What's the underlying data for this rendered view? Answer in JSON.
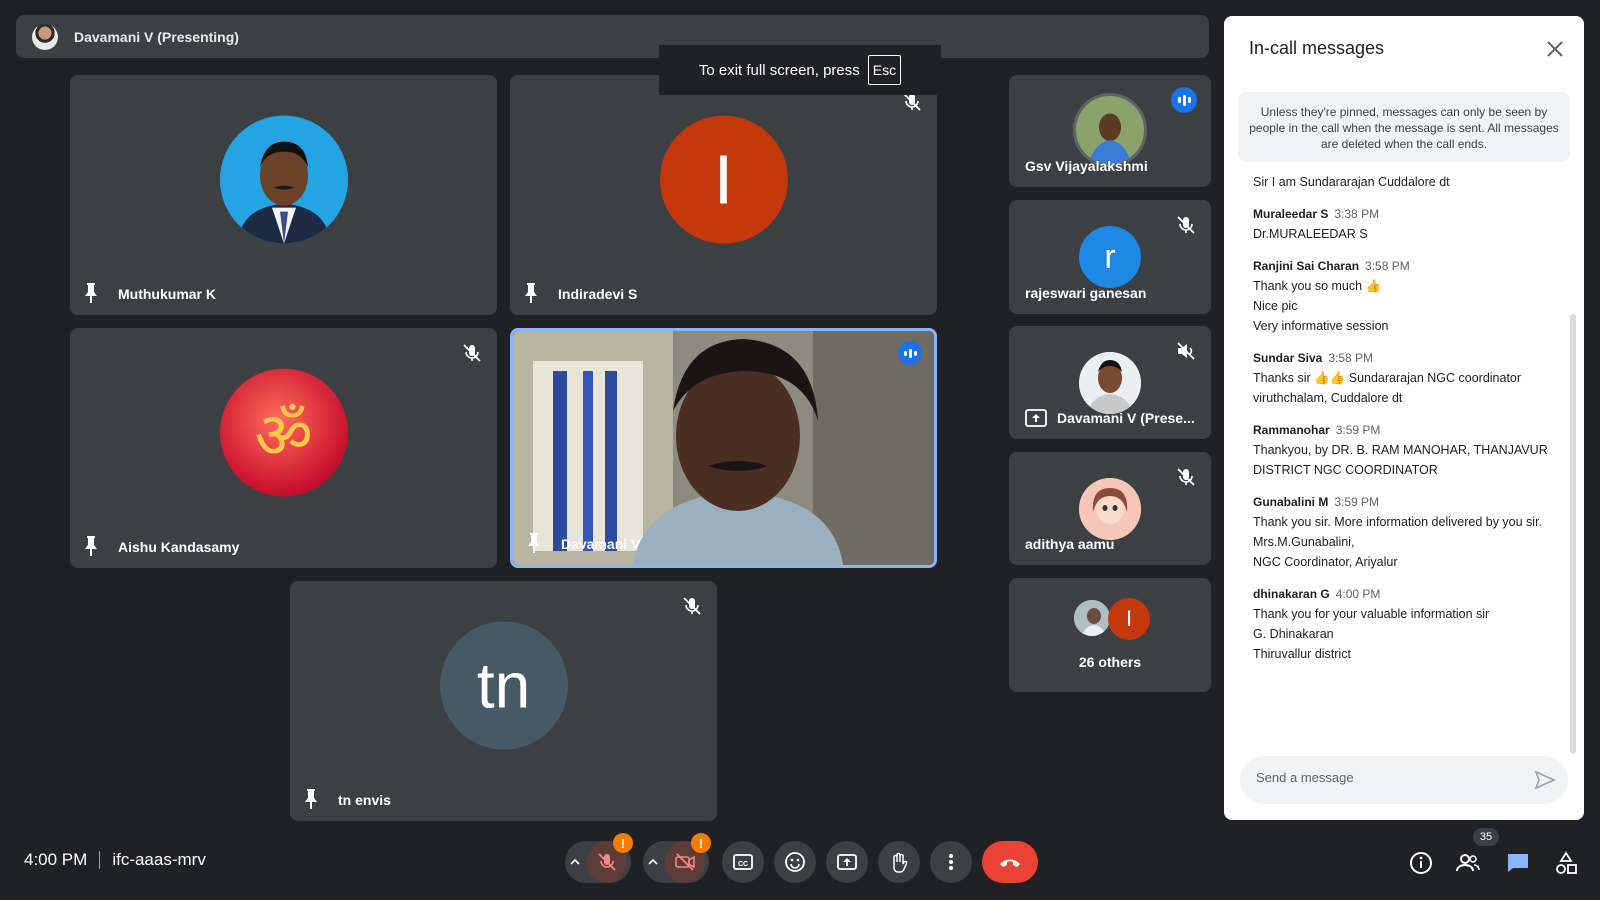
{
  "presenter_bar": {
    "title": "Davamani V (Presenting)"
  },
  "toast": {
    "text": "To exit full screen, press",
    "key": "Esc"
  },
  "tiles": {
    "muthukumar": {
      "name": "Muthukumar K"
    },
    "indiradevi": {
      "name": "Indiradevi S",
      "initial": "I",
      "color": "#c5380c"
    },
    "aishu": {
      "name": "Aishu Kandasamy"
    },
    "davamani_video": {
      "name": "Davamani V"
    },
    "tn_envis": {
      "name": "tn envis",
      "initial": "tn",
      "color": "#455a64"
    }
  },
  "side_tiles": {
    "gsv": {
      "name": "Gsv Vijayalakshmi"
    },
    "rajeswari": {
      "name": "rajeswari ganesan",
      "initial": "r",
      "color": "#1e88e5"
    },
    "davamani_present": {
      "name": "Davamani V (Prese..."
    },
    "adithya": {
      "name": "adithya aamu"
    },
    "others": {
      "label": "26 others",
      "initial": "I",
      "color": "#c5380c"
    }
  },
  "chat": {
    "title": "In-call messages",
    "notice": "Unless they're pinned, messages can only be seen by people in the call when the message is sent. All messages are deleted when the call ends.",
    "cut_line": "Sir I am Sundararajan Cuddalore dt",
    "messages": [
      {
        "sender": "Muraleedar S",
        "time": "3:38 PM",
        "lines": [
          "Dr.MURALEEDAR S"
        ]
      },
      {
        "sender": "Ranjini Sai Charan",
        "time": "3:58 PM",
        "lines": [
          "Thank you so much 👍",
          "Nice pic",
          "Very informative session"
        ]
      },
      {
        "sender": "Sundar Siva",
        "time": "3:58 PM",
        "lines": [
          "Thanks sir 👍👍 Sundararajan NGC coordinator viruthchalam, Cuddalore dt"
        ]
      },
      {
        "sender": "Rammanohar",
        "time": "3:59 PM",
        "lines": [
          "Thankyou, by DR. B. RAM MANOHAR, THANJAVUR DISTRICT NGC COORDINATOR"
        ]
      },
      {
        "sender": "Gunabalini M",
        "time": "3:59 PM",
        "lines": [
          "Thank you sir. More information delivered by you sir.",
          "Mrs.M.Gunabalini,",
          "NGC Coordinator, Ariyalur"
        ]
      },
      {
        "sender": "dhinakaran G",
        "time": "4:00 PM",
        "lines": [
          "Thank you for your valuable information sir",
          "G. Dhinakaran",
          "Thiruvallur district"
        ]
      }
    ],
    "input_placeholder": "Send a message"
  },
  "footer": {
    "time": "4:00 PM",
    "meeting_code": "ifc-aaas-mrv",
    "participant_count": "35",
    "warn_mark": "!"
  }
}
